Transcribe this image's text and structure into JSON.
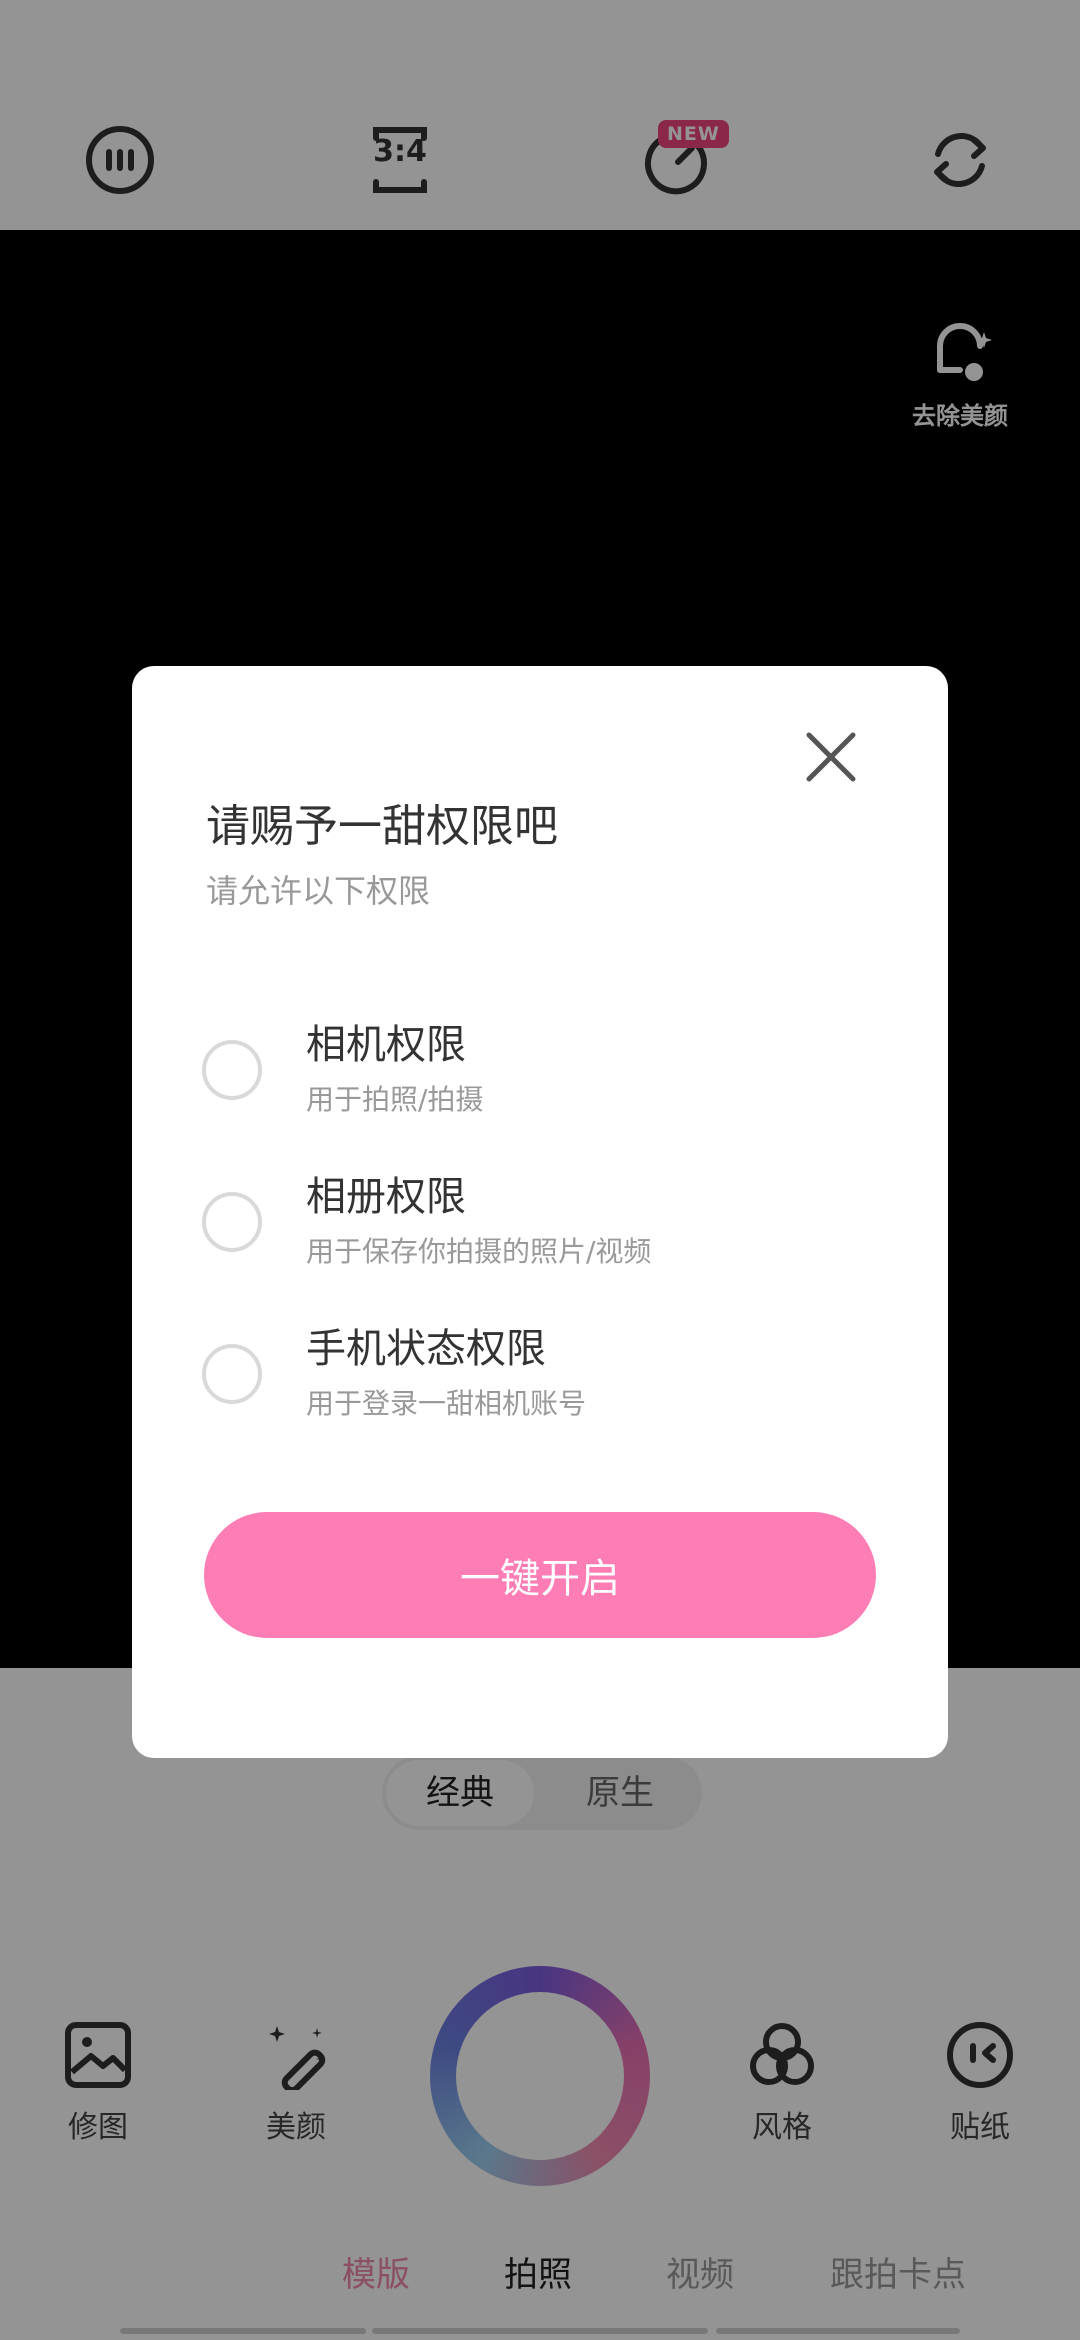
{
  "top_bar": {
    "menu_icon": "more-dots-icon",
    "ratio_label": "3:4",
    "timer_badge": "NEW",
    "timer_icon": "timer-icon",
    "flip_icon": "flip-camera-icon"
  },
  "viewfinder": {
    "beauty_off_label": "去除美颜"
  },
  "mode_toggle": {
    "options": [
      "经典",
      "原生"
    ],
    "selected": "经典"
  },
  "tools": [
    {
      "icon": "image-edit-icon",
      "label": "修图"
    },
    {
      "icon": "magic-wand-icon",
      "label": "美颜"
    },
    {
      "icon": "style-circles-icon",
      "label": "风格"
    },
    {
      "icon": "sticker-face-icon",
      "label": "贴纸"
    }
  ],
  "bottom_tabs": [
    {
      "label": "模版",
      "color": "#f08ab0"
    },
    {
      "label": "拍照",
      "color": "#222222"
    },
    {
      "label": "视频",
      "color": "#9a9a9a"
    },
    {
      "label": "跟拍卡点",
      "color": "#9a9a9a"
    }
  ],
  "dialog": {
    "title": "请赐予一甜权限吧",
    "subtitle": "请允许以下权限",
    "permissions": [
      {
        "name": "相机权限",
        "desc": "用于拍照/拍摄"
      },
      {
        "name": "相册权限",
        "desc": "用于保存你拍摄的照片/视频"
      },
      {
        "name": "手机状态权限",
        "desc": "用于登录一甜相机账号"
      }
    ],
    "button_label": "一键开启"
  },
  "colors": {
    "accent": "#ff7db5",
    "badge": "#f0457f",
    "overlay": "rgba(0,0,0,0.42)"
  }
}
